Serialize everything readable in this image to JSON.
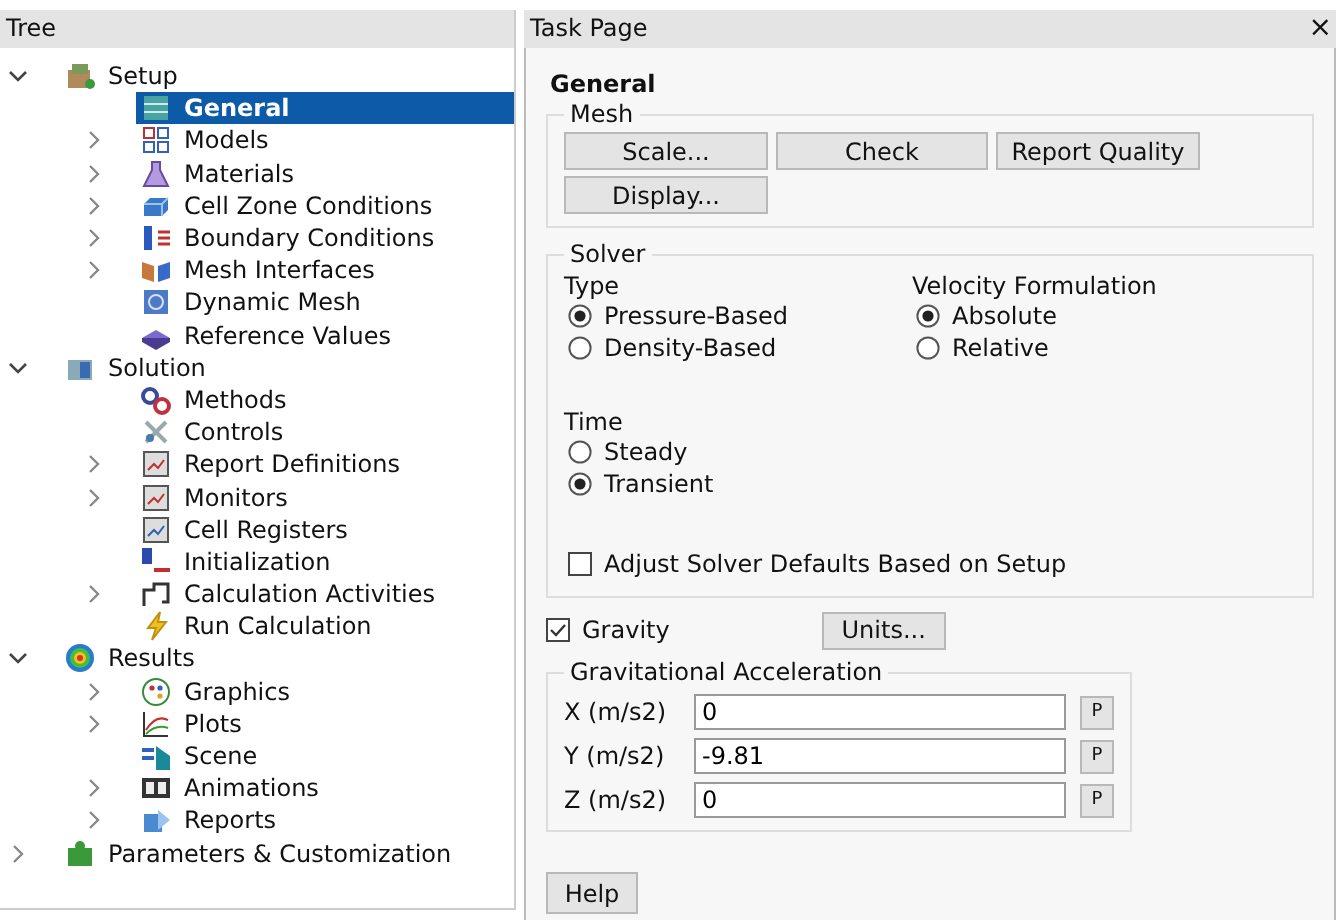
{
  "tree": {
    "title": "Tree",
    "items": [
      {
        "label": "Setup",
        "expanded": true,
        "selected": false,
        "children": [
          {
            "label": "General",
            "selected": true
          },
          {
            "label": "Models",
            "expanded": false,
            "selected": false
          },
          {
            "label": "Materials",
            "expanded": false,
            "selected": false
          },
          {
            "label": "Cell Zone Conditions",
            "expanded": false,
            "selected": false
          },
          {
            "label": "Boundary Conditions",
            "expanded": false,
            "selected": false
          },
          {
            "label": "Mesh Interfaces",
            "expanded": false,
            "selected": false
          },
          {
            "label": "Dynamic Mesh",
            "selected": false
          },
          {
            "label": "Reference Values",
            "selected": false
          }
        ]
      },
      {
        "label": "Solution",
        "expanded": true,
        "selected": false,
        "children": [
          {
            "label": "Methods",
            "selected": false
          },
          {
            "label": "Controls",
            "selected": false
          },
          {
            "label": "Report Definitions",
            "expanded": false,
            "selected": false
          },
          {
            "label": "Monitors",
            "expanded": false,
            "selected": false
          },
          {
            "label": "Cell Registers",
            "selected": false
          },
          {
            "label": "Initialization",
            "selected": false
          },
          {
            "label": "Calculation Activities",
            "expanded": false,
            "selected": false
          },
          {
            "label": "Run Calculation",
            "selected": false
          }
        ]
      },
      {
        "label": "Results",
        "expanded": true,
        "selected": false,
        "children": [
          {
            "label": "Graphics",
            "expanded": false,
            "selected": false
          },
          {
            "label": "Plots",
            "expanded": false,
            "selected": false
          },
          {
            "label": "Scene",
            "selected": false
          },
          {
            "label": "Animations",
            "expanded": false,
            "selected": false
          },
          {
            "label": "Reports",
            "expanded": false,
            "selected": false
          }
        ]
      },
      {
        "label": "Parameters & Customization",
        "expanded": false,
        "selected": false
      }
    ]
  },
  "task_page": {
    "title": "Task Page",
    "close": "×",
    "heading": "General",
    "mesh": {
      "legend": "Mesh",
      "buttons": [
        "Scale...",
        "Check",
        "Report Quality",
        "Display..."
      ]
    },
    "solver": {
      "legend": "Solver",
      "type": {
        "label": "Type",
        "options": [
          {
            "label": "Pressure-Based",
            "selected": true
          },
          {
            "label": "Density-Based",
            "selected": false
          }
        ]
      },
      "velocity": {
        "label": "Velocity Formulation",
        "options": [
          {
            "label": "Absolute",
            "selected": true
          },
          {
            "label": "Relative",
            "selected": false
          }
        ]
      },
      "time": {
        "label": "Time",
        "options": [
          {
            "label": "Steady",
            "selected": false
          },
          {
            "label": "Transient",
            "selected": true
          }
        ]
      },
      "adjust": {
        "label": "Adjust Solver Defaults Based on Setup",
        "checked": false
      }
    },
    "gravity": {
      "label": "Gravity",
      "checked": true
    },
    "units_button": "Units...",
    "acceleration": {
      "legend": "Gravitational Acceleration",
      "rows": [
        {
          "label": "X (m/s2)",
          "value": "0",
          "button": "P"
        },
        {
          "label": "Y (m/s2)",
          "value": "-9.81",
          "button": "P"
        },
        {
          "label": "Z (m/s2)",
          "value": "0",
          "button": "P"
        }
      ]
    },
    "help_button": "Help"
  }
}
